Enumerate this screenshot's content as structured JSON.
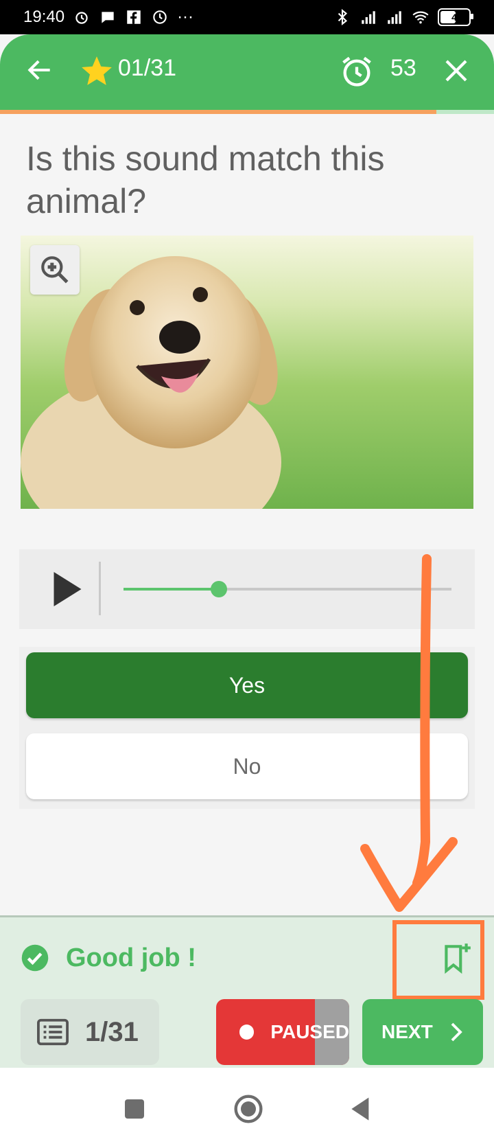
{
  "status_bar": {
    "time": "19:40",
    "battery_level": "4"
  },
  "header": {
    "question_counter": "01/31",
    "timer": "53"
  },
  "question": {
    "text": "Is this sound match this animal?"
  },
  "audio": {
    "progress_fraction": 0.29
  },
  "answers": {
    "options": [
      {
        "label": "Yes",
        "selected": true
      },
      {
        "label": "No",
        "selected": false
      }
    ]
  },
  "feedback": {
    "message": "Good job !"
  },
  "footer": {
    "list_counter": "1/31",
    "paused_label": "PAUSED",
    "next_label": "NEXT"
  },
  "colors": {
    "primary_green": "#4cb961",
    "dark_green": "#2b7d2e",
    "paused_red": "#e43737",
    "annotation_orange": "#ff7b3e",
    "progress_orange": "#f6a15e"
  }
}
